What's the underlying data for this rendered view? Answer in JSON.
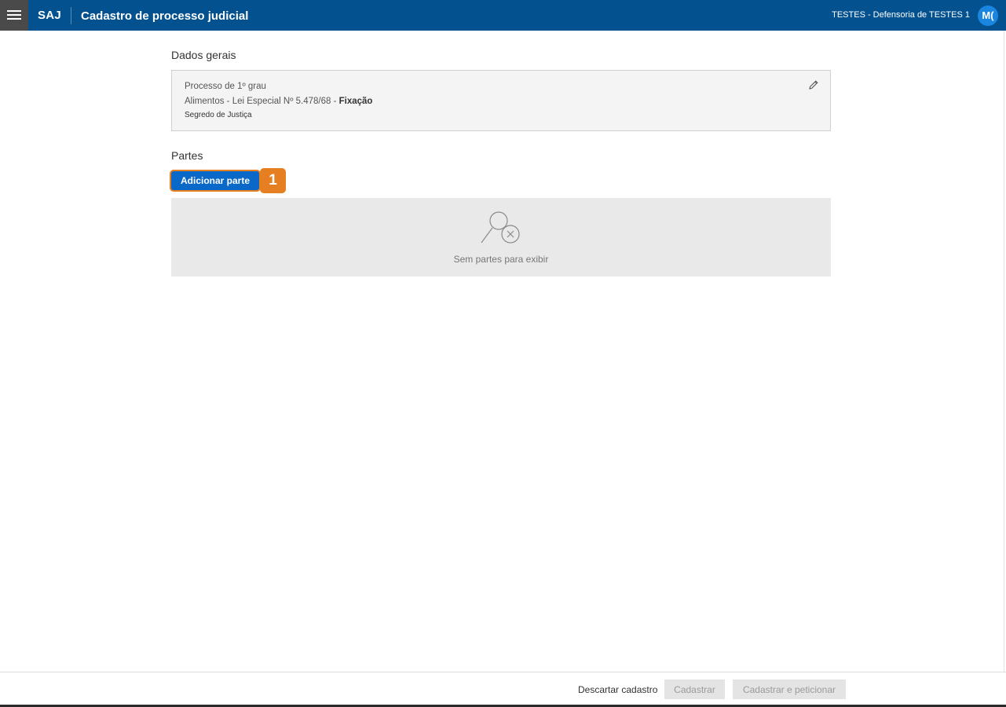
{
  "header": {
    "brand": "SAJ",
    "title": "Cadastro de processo judicial",
    "organization": "TESTES - Defensoria de TESTES 1",
    "avatar_initials": "M("
  },
  "dados_gerais": {
    "section_title": "Dados gerais",
    "line1": "Processo de 1º grau",
    "line2_prefix": "Alimentos - Lei Especial Nº 5.478/68 - ",
    "line2_bold": "Fixação",
    "line3": "Segredo de Justiça"
  },
  "partes": {
    "section_title": "Partes",
    "add_button_label": "Adicionar parte",
    "step_badge": "1",
    "empty_message": "Sem partes para exibir"
  },
  "footer": {
    "discard_label": "Descartar cadastro",
    "register_label": "Cadastrar",
    "register_petition_label": "Cadastrar e peticionar"
  },
  "colors": {
    "header_bg": "#04518f",
    "primary_button": "#0a68c8",
    "highlight": "#e67e22"
  }
}
